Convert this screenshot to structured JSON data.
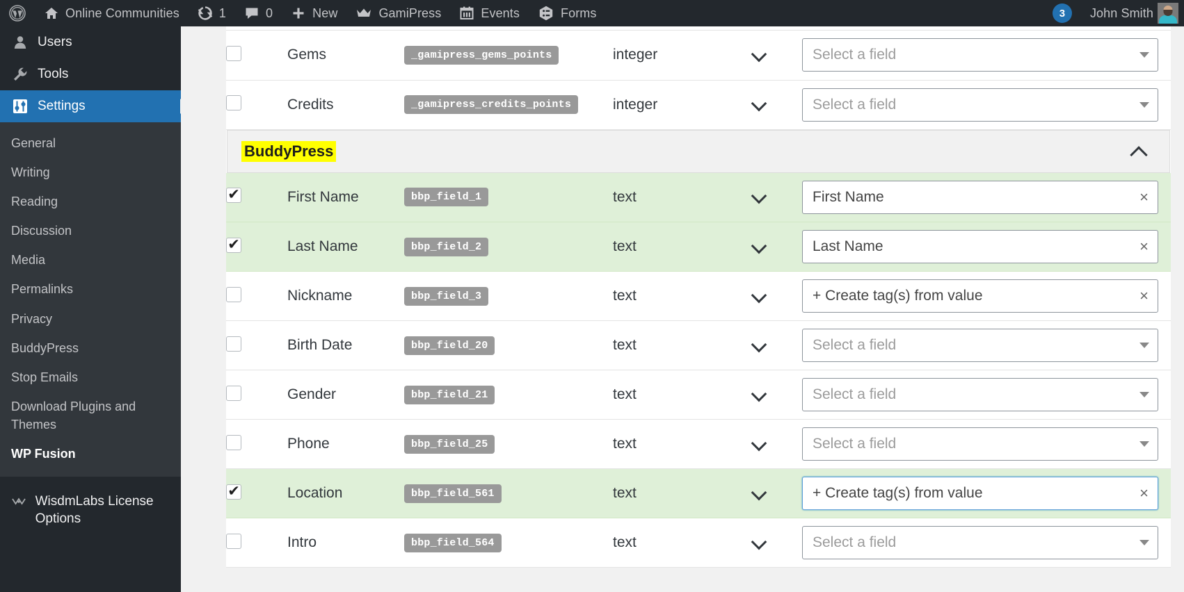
{
  "adminbar": {
    "site_name": "Online Communities",
    "updates_count": "1",
    "comments_count": "0",
    "new_label": "New",
    "gamipress_label": "GamiPress",
    "events_label": "Events",
    "forms_label": "Forms",
    "notification_count": "3",
    "user_name": "John Smith",
    "icons": {
      "wordpress": "wordpress-logo-icon",
      "home": "home-icon",
      "updates": "updates-icon",
      "comments": "comment-bubble-icon",
      "new": "plus-icon",
      "gamipress": "crown-icon",
      "events": "calendar-icon",
      "forms": "forms-icon",
      "avatar": "user-avatar"
    }
  },
  "sidebar": {
    "top_items": [
      {
        "label": "Users",
        "icon": "users-icon",
        "current": false
      },
      {
        "label": "Tools",
        "icon": "wrench-icon",
        "current": false
      },
      {
        "label": "Settings",
        "icon": "settings-sliders-icon",
        "current": true
      }
    ],
    "submenu": [
      {
        "label": "General",
        "current": false
      },
      {
        "label": "Writing",
        "current": false
      },
      {
        "label": "Reading",
        "current": false
      },
      {
        "label": "Discussion",
        "current": false
      },
      {
        "label": "Media",
        "current": false
      },
      {
        "label": "Permalinks",
        "current": false
      },
      {
        "label": "Privacy",
        "current": false
      },
      {
        "label": "BuddyPress",
        "current": false
      },
      {
        "label": "Stop Emails",
        "current": false
      },
      {
        "label": "Download Plugins and Themes",
        "current": false
      },
      {
        "label": "WP Fusion",
        "current": true
      }
    ],
    "bottom_items": [
      {
        "label": "WisdmLabs License Options",
        "icon": "wisdmlabs-icon",
        "current": false
      }
    ]
  },
  "main": {
    "top_rows": [
      {
        "checked": false,
        "label": "Gems",
        "meta_key": "_gamipress_gems_points",
        "type": "integer",
        "select": {
          "value": "Select a field",
          "placeholder": true,
          "clearable": false,
          "focused": false
        }
      },
      {
        "checked": false,
        "label": "Credits",
        "meta_key": "_gamipress_credits_points",
        "type": "integer",
        "select": {
          "value": "Select a field",
          "placeholder": true,
          "clearable": false,
          "focused": false
        }
      }
    ],
    "group": {
      "title": "BuddyPress",
      "collapsed": false,
      "toggle_icon": "chevron-up-icon",
      "rows": [
        {
          "checked": true,
          "label": "First Name",
          "meta_key": "bbp_field_1",
          "type": "text",
          "select": {
            "value": "First Name",
            "placeholder": false,
            "clearable": true,
            "focused": false
          }
        },
        {
          "checked": true,
          "label": "Last Name",
          "meta_key": "bbp_field_2",
          "type": "text",
          "select": {
            "value": "Last Name",
            "placeholder": false,
            "clearable": true,
            "focused": false
          }
        },
        {
          "checked": false,
          "label": "Nickname",
          "meta_key": "bbp_field_3",
          "type": "text",
          "select": {
            "value": "+ Create tag(s) from value",
            "placeholder": false,
            "clearable": true,
            "focused": false
          }
        },
        {
          "checked": false,
          "label": "Birth Date",
          "meta_key": "bbp_field_20",
          "type": "text",
          "select": {
            "value": "Select a field",
            "placeholder": true,
            "clearable": false,
            "focused": false
          }
        },
        {
          "checked": false,
          "label": "Gender",
          "meta_key": "bbp_field_21",
          "type": "text",
          "select": {
            "value": "Select a field",
            "placeholder": true,
            "clearable": false,
            "focused": false
          }
        },
        {
          "checked": false,
          "label": "Phone",
          "meta_key": "bbp_field_25",
          "type": "text",
          "select": {
            "value": "Select a field",
            "placeholder": true,
            "clearable": false,
            "focused": false
          }
        },
        {
          "checked": true,
          "label": "Location",
          "meta_key": "bbp_field_561",
          "type": "text",
          "select": {
            "value": "+ Create tag(s) from value",
            "placeholder": false,
            "clearable": true,
            "focused": true
          }
        },
        {
          "checked": false,
          "label": "Intro",
          "meta_key": "bbp_field_564",
          "type": "text",
          "select": {
            "value": "Select a field",
            "placeholder": true,
            "clearable": false,
            "focused": false
          }
        }
      ]
    }
  },
  "colors": {
    "adminbar_bg": "#23282d",
    "sidebar_bg": "#23282d",
    "submenu_bg": "#32373c",
    "accent_blue": "#2271b1",
    "row_enabled_bg": "#dff0d8",
    "highlight_yellow": "#ffff00",
    "meta_tag_bg": "#999999"
  }
}
